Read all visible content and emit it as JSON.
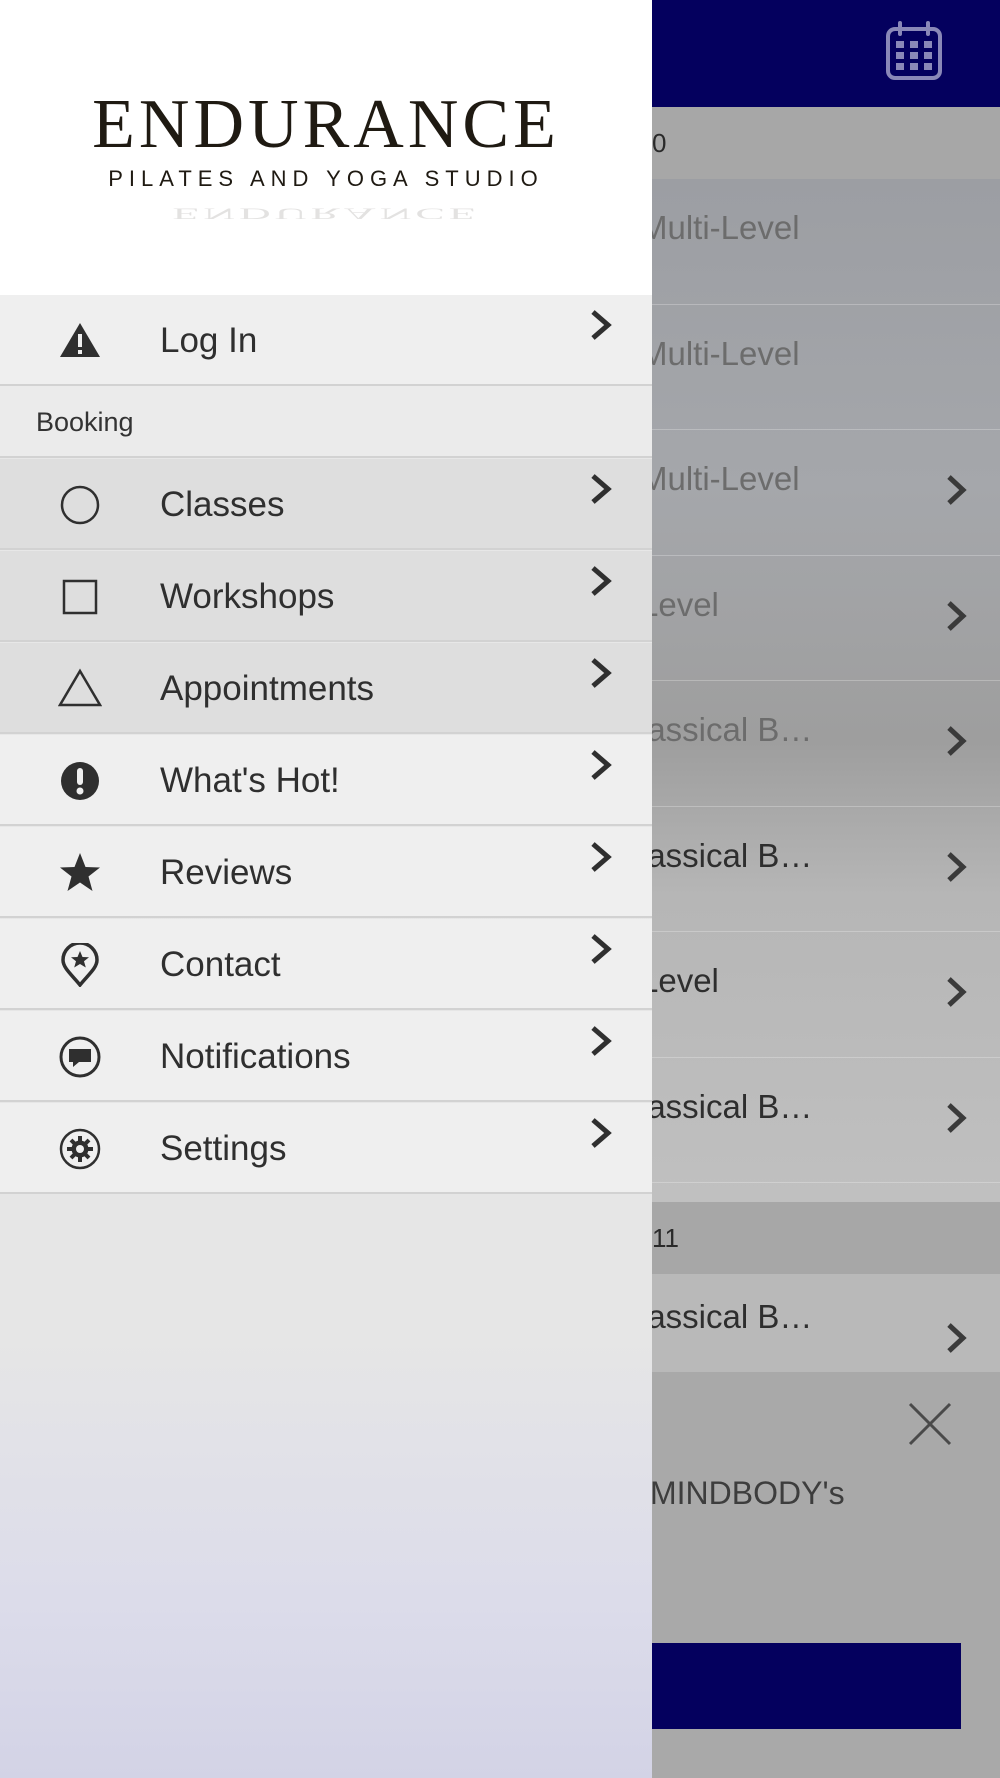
{
  "colors": {
    "header_bg": "#04005e",
    "drawer_bg": "#e8e8e8",
    "menu_item_bg": "#efefef",
    "menu_item_selected_bg": "#dedede",
    "menu_text": "#2f2f2f"
  },
  "background": {
    "date_bar_1": "0",
    "rows": [
      {
        "label": "Multi-Level",
        "has_chevron": false
      },
      {
        "label": "Multi-Level",
        "has_chevron": false
      },
      {
        "label": "Multi-Level",
        "has_chevron": true
      },
      {
        "label": "Level",
        "has_chevron": true
      },
      {
        "label": "lassical B…",
        "has_chevron": true
      },
      {
        "label": "lassical B…",
        "has_chevron": true
      },
      {
        "label": "Level",
        "has_chevron": true
      },
      {
        "label": "lassical B…",
        "has_chevron": true
      }
    ],
    "date_bar_2": "11",
    "last_row": {
      "label": "lassical B…"
    },
    "panel_text": "MINDBODY's",
    "icons": {
      "calendar": "calendar-icon",
      "close": "close-icon",
      "chevron": "chevron-right-icon"
    }
  },
  "drawer": {
    "logo": {
      "title": "ENDURANCE",
      "subtitle": "PILATES AND YOGA STUDIO"
    },
    "login": {
      "label": "Log In",
      "icon": "warning-triangle-icon"
    },
    "section_booking": "Booking",
    "booking_items": [
      {
        "label": "Classes",
        "icon": "circle-outline-icon"
      },
      {
        "label": "Workshops",
        "icon": "square-outline-icon"
      },
      {
        "label": "Appointments",
        "icon": "triangle-outline-icon"
      }
    ],
    "other_items": [
      {
        "label": "What's Hot!",
        "icon": "exclamation-circle-icon"
      },
      {
        "label": "Reviews",
        "icon": "star-icon"
      },
      {
        "label": "Contact",
        "icon": "location-pin-icon"
      },
      {
        "label": "Notifications",
        "icon": "chat-bubble-icon"
      },
      {
        "label": "Settings",
        "icon": "gear-icon"
      }
    ]
  }
}
